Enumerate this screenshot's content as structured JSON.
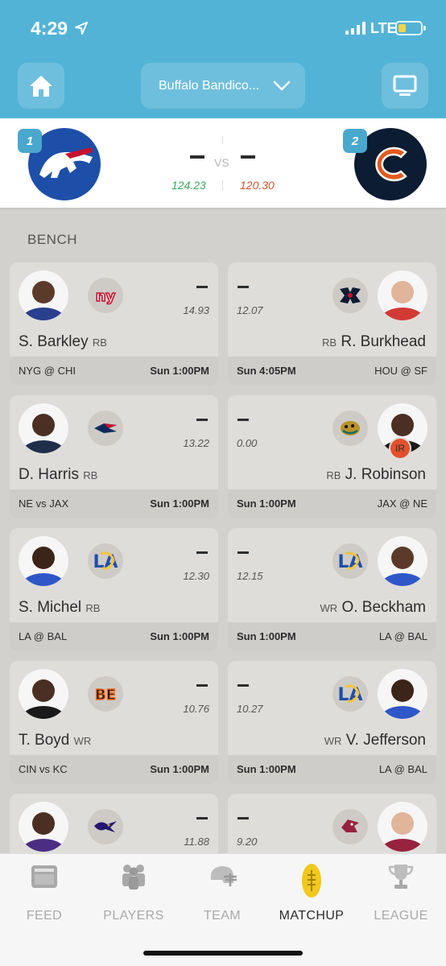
{
  "status_bar": {
    "time": "4:29",
    "network": "LTE"
  },
  "header": {
    "league_name": "Buffalo Bandico..."
  },
  "matchup": {
    "home": {
      "seed": "1",
      "score": "–",
      "projected": "124.23"
    },
    "separator": "VS",
    "away": {
      "seed": "2",
      "score": "–",
      "projected": "120.30"
    }
  },
  "bench": {
    "label": "BENCH",
    "rows": [
      {
        "left": {
          "name": "S. Barkley",
          "pos": "RB",
          "points": "–",
          "projected": "14.93",
          "game": "NYG @ CHI",
          "time": "Sun 1:00PM"
        },
        "right": {
          "name": "R. Burkhead",
          "pos": "RB",
          "points": "–",
          "projected": "12.07",
          "game": "HOU @ SF",
          "time": "Sun 4:05PM"
        }
      },
      {
        "left": {
          "name": "D. Harris",
          "pos": "RB",
          "points": "–",
          "projected": "13.22",
          "game": "NE vs JAX",
          "time": "Sun 1:00PM"
        },
        "right": {
          "name": "J. Robinson",
          "pos": "RB",
          "points": "–",
          "projected": "0.00",
          "game": "JAX @ NE",
          "time": "Sun 1:00PM",
          "status": "IR"
        }
      },
      {
        "left": {
          "name": "S. Michel",
          "pos": "RB",
          "points": "–",
          "projected": "12.30",
          "game": "LA @ BAL",
          "time": "Sun 1:00PM"
        },
        "right": {
          "name": "O. Beckham",
          "pos": "WR",
          "points": "–",
          "projected": "12.15",
          "game": "LA @ BAL",
          "time": "Sun 1:00PM"
        }
      },
      {
        "left": {
          "name": "T. Boyd",
          "pos": "WR",
          "points": "–",
          "projected": "10.76",
          "game": "CIN vs KC",
          "time": "Sun 1:00PM"
        },
        "right": {
          "name": "V. Jefferson",
          "pos": "WR",
          "points": "–",
          "projected": "10.27",
          "game": "LA @ BAL",
          "time": "Sun 1:00PM"
        }
      },
      {
        "left": {
          "points": "–",
          "projected": "11.88"
        },
        "right": {
          "points": "–",
          "projected": "9.20"
        }
      }
    ]
  },
  "tabs": [
    {
      "label": "FEED",
      "icon": "feed-icon"
    },
    {
      "label": "PLAYERS",
      "icon": "players-icon"
    },
    {
      "label": "TEAM",
      "icon": "helmet-icon"
    },
    {
      "label": "MATCHUP",
      "icon": "football-icon",
      "active": true
    },
    {
      "label": "LEAGUE",
      "icon": "trophy-icon"
    }
  ],
  "colors": {
    "header": "#53b3d7",
    "positive": "#3aa85b",
    "negative": "#d0532a",
    "seed": "#4aa7cd"
  }
}
